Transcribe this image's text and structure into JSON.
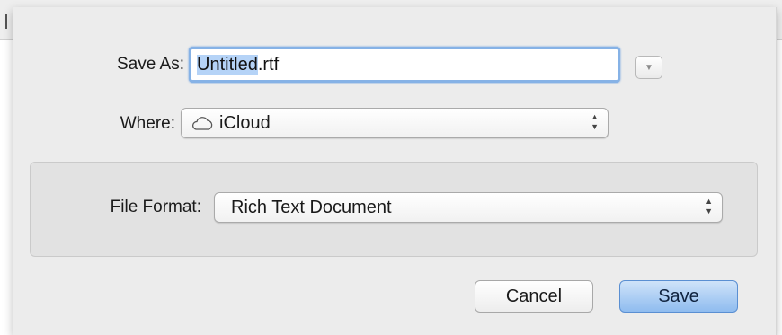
{
  "dialog": {
    "save_as_label": "Save As:",
    "filename": {
      "selected_part": "Untitled",
      "extension": ".rtf"
    },
    "expand_icon": "triangle-down-icon",
    "where_label": "Where:",
    "where_value": "iCloud",
    "where_icon": "cloud-icon",
    "file_format_label": "File Format:",
    "file_format_value": "Rich Text Document",
    "cancel_label": "Cancel",
    "save_label": "Save",
    "colors": {
      "focus_ring": "#86b2e6",
      "selection": "#b5d3f7",
      "default_button": "#8fbcef"
    }
  }
}
